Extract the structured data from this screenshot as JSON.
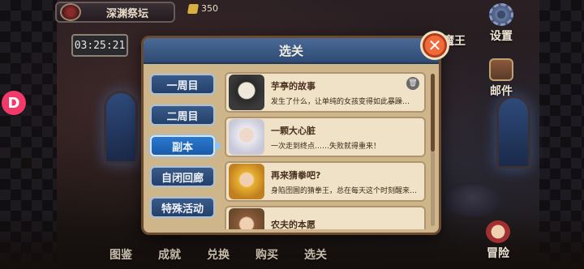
{
  "top": {
    "location_title": "深渊祭坛",
    "gem_count": "350",
    "timer": "03:25:21"
  },
  "side": {
    "king_label": "魔王",
    "settings_label": "设置",
    "mail_label": "邮件",
    "adventure_label": "冒险"
  },
  "bottom_nav": {
    "items": [
      "图鉴",
      "成就",
      "兑换",
      "购买",
      "选关"
    ]
  },
  "dialog": {
    "title": "选关",
    "close_symbol": "✕",
    "tabs": [
      {
        "label": "一周目",
        "active": false
      },
      {
        "label": "二周目",
        "active": false
      },
      {
        "label": "副本",
        "active": true
      },
      {
        "label": "自闭回廊",
        "active": false
      },
      {
        "label": "特殊活动",
        "active": false
      }
    ],
    "stages": [
      {
        "title": "芋亭的故事",
        "desc": "发生了什么，让单纯的女孩变得如此暴躁…"
      },
      {
        "title": "一颗大心脏",
        "desc": "一次走到终点……失败就得重来！"
      },
      {
        "title": "再来猜拳吧?",
        "desc": "身陷囹圄的猜拳王，总在每天这个时刻醒来…"
      },
      {
        "title": "农夫的本愿",
        "desc": ""
      }
    ],
    "trash_symbol": "🗑"
  },
  "colors": {
    "header": "#2e4a74",
    "tab_active": "#1a5aa8",
    "close": "#f06a3a",
    "parchment": "#cfb58a"
  }
}
